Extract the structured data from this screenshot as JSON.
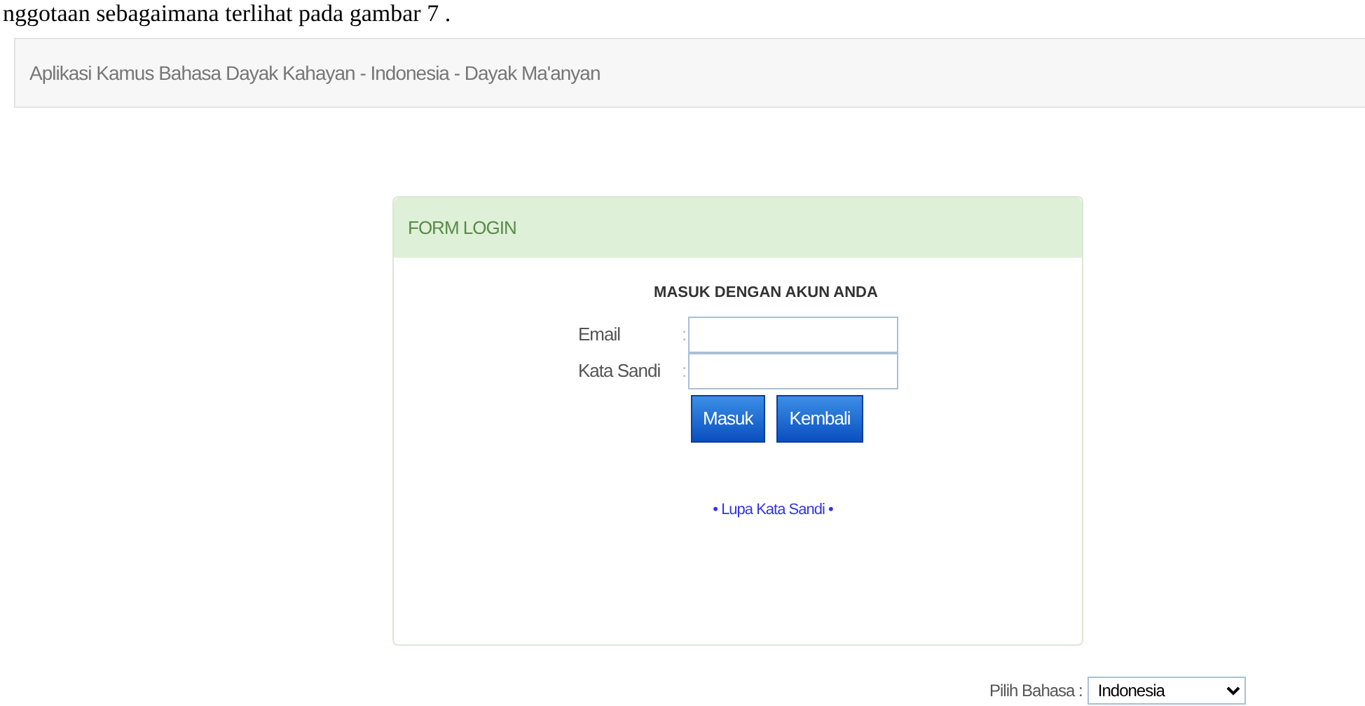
{
  "document_text": "nggotaan sebagaimana terlihat pada gambar 7 .",
  "navbar": {
    "brand": "Aplikasi Kamus Bahasa Dayak Kahayan - Indonesia - Dayak Ma'anyan"
  },
  "panel": {
    "title": "FORM LOGIN",
    "heading": "MASUK DENGAN AKUN ANDA",
    "fields": [
      {
        "label": "Email",
        "separator": ":"
      },
      {
        "label": "Kata Sandi",
        "separator": ":"
      }
    ],
    "buttons": [
      "Masuk",
      "Kembali"
    ],
    "link": "• Lupa Kata Sandi •"
  },
  "language": {
    "label": "Pilih Bahasa :",
    "value": "Indonesia"
  }
}
